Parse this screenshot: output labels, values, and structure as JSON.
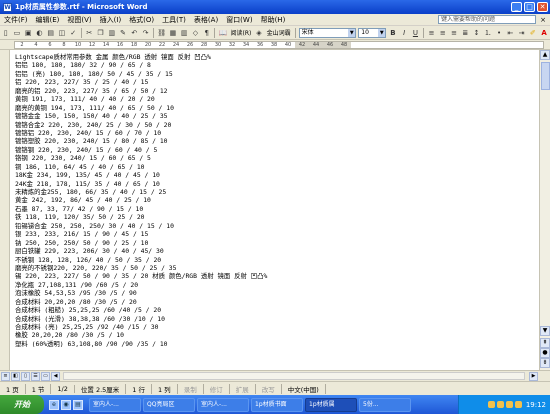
{
  "window": {
    "title": "1p材质属性参数.rtf - Microsoft Word",
    "app_icon": "W",
    "min": "_",
    "max": "□",
    "close": "✕"
  },
  "menu": {
    "items": [
      "文件(F)",
      "编辑(E)",
      "视图(V)",
      "插入(I)",
      "格式(O)",
      "工具(T)",
      "表格(A)",
      "窗口(W)",
      "帮助(H)"
    ],
    "help_placeholder": "键入需要帮助的问题",
    "close": "×"
  },
  "toolbar": {
    "read_label": "阅读(R)",
    "kingsoft_label": "金山词霸",
    "font": "宋体",
    "size": "10",
    "bold": "B",
    "italic": "I",
    "underline": "U"
  },
  "ruler": {
    "ticks": [
      "2",
      "4",
      "6",
      "8",
      "10",
      "12",
      "14",
      "16",
      "18",
      "20",
      "22",
      "24",
      "26",
      "28",
      "30",
      "32",
      "34",
      "36",
      "38",
      "40",
      "42",
      "44",
      "46",
      "48"
    ]
  },
  "document": {
    "lines": [
      "Lightscape质材常用参数 金属 颜色/RGB 透射 镜面 反射 凹凸%",
      "铝铝 180, 180, 180/ 32 / 90 / 65 / 8",
      "铝铝 (亮) 180, 180, 180/ 50 / 45 / 35 / 15",
      "铝 220, 223, 227/ 35 / 25 / 40 / 15",
      "磨亮的铝 220, 223, 227/ 35 / 65 / 50 / 12",
      "黄铜 191, 173, 111/ 40 / 40 / 20 / 20",
      "磨亮的黄铜 194, 173, 111/ 40 / 65 / 50 / 10",
      "镀铬金金 150, 150, 150/ 40 / 40 / 25 / 35",
      "镀铬合金2 220, 230, 240/ 25 / 30 / 50 / 20",
      "镀铬铝 220, 230, 240/ 15 / 60 / 70 / 10",
      "镀铬塑胶 220, 230, 240/ 15 / 80 / 85 / 10",
      "镀铬钢 220, 230, 240/ 15 / 60 / 40 / 5",
      "铬钢 220, 230, 240/ 15 / 60 / 65 / 5",
      "铜 186, 110, 64/ 45 / 40 / 65 / 10",
      "18K金 234, 199, 135/ 45 / 40 / 45 / 10",
      "24K金 218, 178, 115/ 35 / 40 / 65 / 10",
      "未精炼的金255, 180, 66/ 35 / 40 / 15 / 25",
      "黄金 242, 192, 86/ 45 / 40 / 25 / 10",
      "石墨 87, 33, 77/ 42 / 90 / 15 / 10",
      "铁 118, 119, 120/ 35/ 50 / 25 / 20",
      "铅锡锑合金 250, 250, 250/ 30 / 40 / 15 / 10",
      "银 233, 233, 216/ 15 / 90 / 45 / 15",
      "钠 250, 250, 250/ 50 / 90 / 25 / 10",
      "厨白铁罐 229, 223, 206/ 30 / 40 / 45/ 30",
      "不锈钢 128, 128, 126/ 40 / 50 / 35 / 20",
      "磨亮的不锈钢220, 220, 220/ 35 / 50 / 25 / 35",
      "锡 220, 223, 227/ 50 / 90 / 35 / 20  材质 颜色/RGB 透射 镜面 反射 凹凸%",
      "净化瓶 27,108,131 /90 /60 /5 / 20",
      "泡沫橡胶 54,53,53 /95 /30 /5 / 90",
      "合成材料 20,20,20 /80 /30 /5 / 20",
      "合成材料 (粗糙) 25,25,25 /60 /40 /5 / 20",
      "合成材料 (光滑) 38,38,38 /60 /30 /10 / 10",
      "合成材料 (亮) 25,25,25 /92 /40 /15 / 30",
      "橡胶 20,20,20 /80 /30 /5 / 10",
      "塑料 (60%透明) 63,108,80 /90 /90 /35 / 10"
    ]
  },
  "statusbar": {
    "items": [
      "1 页",
      "1 节",
      "1/2",
      "位置 2.5厘米",
      "1 行",
      "1 列",
      "录制",
      "修订",
      "扩展",
      "改写",
      "中文(中国)"
    ],
    "dim": [
      false,
      false,
      false,
      false,
      false,
      false,
      true,
      true,
      true,
      true,
      false
    ]
  },
  "taskbar": {
    "start": "开始",
    "quick": [
      "e",
      "◉",
      "▤"
    ],
    "tasks": [
      "室内人-...",
      "QQ亮局区",
      "室内人-...",
      "1p材质书面",
      "1p材质属",
      "5份..."
    ],
    "active_index": 4,
    "clock": "19:12"
  }
}
